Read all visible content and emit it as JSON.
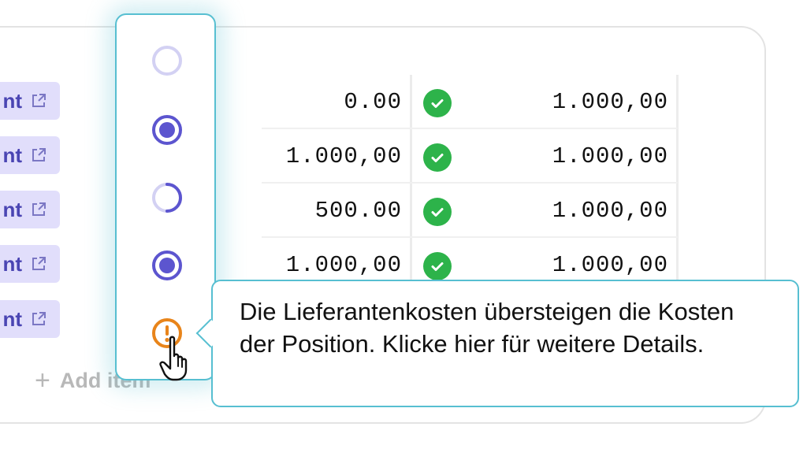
{
  "rows": [
    {
      "chip_label": "nt",
      "amount": "0.00",
      "status": "check",
      "total": "1.000,00"
    },
    {
      "chip_label": "nt",
      "amount": "1.000,00",
      "status": "check",
      "total": "1.000,00"
    },
    {
      "chip_label": "nt",
      "amount": "500.00",
      "status": "check",
      "total": "1.000,00"
    },
    {
      "chip_label": "nt",
      "amount": "1.000,00",
      "status": "check",
      "total": "1.000,00"
    },
    {
      "chip_label": "nt"
    }
  ],
  "chip_icon": "external-link-icon",
  "add_item": {
    "icon": "plus-icon",
    "label": "Add item"
  },
  "status_options": [
    {
      "name": "empty-circle-icon",
      "state": "empty",
      "color": "#d3d1f3"
    },
    {
      "name": "filled-radio-icon",
      "state": "selected",
      "color": "#5c55cf"
    },
    {
      "name": "partial-circle-icon",
      "state": "partial",
      "color": "#5c55cf"
    },
    {
      "name": "filled-radio-icon",
      "state": "selected",
      "color": "#5c55cf"
    },
    {
      "name": "warning-circle-icon",
      "state": "warning",
      "color": "#e8841a"
    }
  ],
  "tooltip": {
    "text": "Die Lieferantenkosten übersteigen die Kosten der Position.  Klicke hier für weitere Details."
  },
  "colors": {
    "accent": "#5c55cf",
    "chip_bg": "#e1defb",
    "success": "#2db34a",
    "warning": "#e8841a",
    "highlight": "#57bfd1"
  }
}
